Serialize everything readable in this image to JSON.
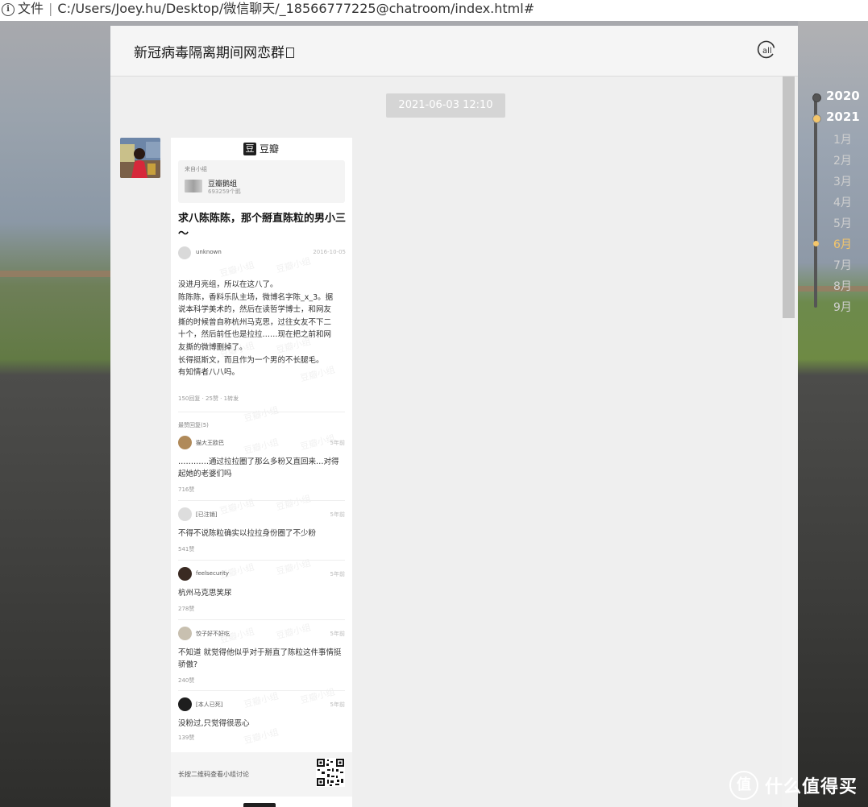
{
  "browser": {
    "scheme_label": "文件",
    "url": "C:/Users/Joey.hu/Desktop/微信聊天/_18566777225@chatroom/index.html#"
  },
  "chat": {
    "title": "新冠病毒隔离期间网恋群",
    "header_icon": "at-all-icon",
    "timestamp": "2021-06-03 12:10"
  },
  "card": {
    "app_name": "豆瓣",
    "app_mark": "豆",
    "watermark": "豆瓣小组",
    "from_group_label": "来自小组",
    "group_name": "豆瓣鹅组",
    "group_members": "693259个鹅",
    "post_title": "求八陈陈陈，那个掰直陈粒的男小三～",
    "author": "unknown",
    "post_date": "2016-10-05",
    "body_lines": [
      "没进月亮组，所以在这八了。",
      "陈陈陈，香料乐队主场，微博名字陈_x_3。据",
      "说本科学美术的，然后在读哲学博士，和网友",
      "撕的时候曾自称杭州马克思，过往女友不下二",
      "十个，然后前任也是拉拉……现在把之前和网",
      "友撕的微博删掉了。",
      "长得挺斯文，而且作为一个男的不长腿毛。",
      "有知情者八八吗。"
    ],
    "stats": "150回复 · 25赞 · 1转发",
    "hot_replies_label": "最赞回复(5)",
    "comments": [
      {
        "name": "猫大王欧巴",
        "time": "5年前",
        "text": "…………通过拉拉圈了那么多粉又直回来…对得起她的老婆们吗",
        "likes": "716赞"
      },
      {
        "name": "[已注销]",
        "time": "5年前",
        "text": "不得不说陈粒确实以拉拉身份圈了不少粉",
        "likes": "541赞"
      },
      {
        "name": "feelsecurity",
        "time": "5年前",
        "text": "杭州马克思笑尿",
        "likes": "278赞"
      },
      {
        "name": "饺子好不好吃",
        "time": "5年前",
        "text": "不知道 就觉得他似乎对于掰直了陈粒这件事情挺骄傲?",
        "likes": "240赞"
      },
      {
        "name": "[本人已死]",
        "time": "5年前",
        "text": "没粉过,只觉得很恶心",
        "likes": "139赞"
      }
    ],
    "qr_text": "长按二维码查看小组讨论"
  },
  "timeline": {
    "years": [
      "2020",
      "2021"
    ],
    "months": [
      "1月",
      "2月",
      "3月",
      "4月",
      "5月",
      "6月",
      "7月",
      "8月",
      "9月"
    ],
    "active_month": "6月",
    "active_color": "#f5c66a"
  },
  "watermark_site": {
    "icon_char": "值",
    "text": "什么值得买"
  },
  "colors": {
    "chat_bg": "#efefef",
    "header_bg": "#f5f5f5",
    "timestamp_bg": "#d5d5d5",
    "accent_gold": "#f5c66a"
  }
}
